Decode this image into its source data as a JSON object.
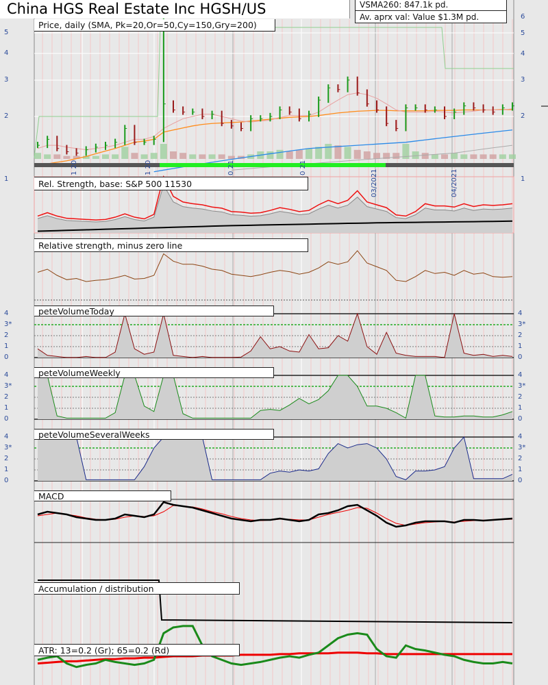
{
  "header": {
    "title": "China HGS Real Estate Inc HGSH/US",
    "vsma": "VSMA260: 847.1k pd.",
    "avg_value": "Av. aprx val: Value $1.3M pd."
  },
  "panels": {
    "price": "Price, daily (SMA, Pk=20,Or=50,Cy=150,Gry=200)",
    "rs": "Rel. Strength, base: S&P 500 11530",
    "rs_zero": "Relative strength, minus zero line",
    "vol_today": "peteVolumeToday",
    "vol_weekly": "peteVolumeWeekly",
    "vol_several": "peteVolumeSeveralWeeks",
    "macd": "MACD",
    "accdist": "Accumulation / distribution",
    "atr": "ATR: 13=0.2 (Gr); 65=0.2 (Rd)"
  },
  "axes": {
    "price_left": [
      "5",
      "4",
      "3",
      "2"
    ],
    "price_right": [
      "6",
      "5",
      "4",
      "3",
      "2"
    ],
    "rs": "1",
    "vol": [
      "4",
      "3*",
      "2",
      "1",
      "0"
    ],
    "dates": [
      "1 20",
      "1 20",
      "0 21",
      "0 21",
      "03/2021",
      "04/2021"
    ]
  },
  "colors": {
    "up": "#1a9a1a",
    "down": "#9a1a1a",
    "sma20": "#e8a0a0",
    "sma50": "#ff8c1a",
    "sma150": "#2a8ae8",
    "sma200": "#aaaaaa",
    "rs": "#ee1111",
    "rszero": "#8b4513",
    "vol": "#8b1010",
    "volw": "#1a8a1a",
    "vols": "#1a2a8a"
  },
  "chart_data": [
    {
      "type": "bar",
      "title": "Price, daily",
      "scale": "log",
      "close": [
        1.45,
        1.55,
        1.4,
        1.35,
        1.33,
        1.38,
        1.42,
        1.45,
        1.5,
        1.75,
        1.5,
        1.5,
        1.55,
        2.3,
        2.15,
        2.1,
        2.1,
        2.0,
        2.05,
        1.85,
        1.8,
        1.75,
        1.95,
        1.95,
        2.0,
        2.15,
        2.1,
        1.95,
        2.05,
        2.4,
        2.75,
        2.7,
        3.0,
        2.6,
        2.3,
        2.15,
        1.85,
        1.75,
        2.2,
        2.2,
        2.15,
        2.15,
        2.0,
        2.1,
        2.25,
        2.2,
        2.15,
        2.1,
        2.2,
        2.25
      ],
      "spike_high": 6.0,
      "sma20": [
        1.4,
        1.45,
        1.45,
        1.42,
        1.4,
        1.38,
        1.4,
        1.42,
        1.45,
        1.5,
        1.55,
        1.55,
        1.6,
        1.75,
        1.85,
        1.95,
        2.0,
        2.05,
        2.05,
        2.0,
        1.95,
        1.9,
        1.88,
        1.9,
        1.92,
        1.98,
        2.02,
        2.02,
        2.02,
        2.1,
        2.25,
        2.4,
        2.55,
        2.6,
        2.55,
        2.45,
        2.3,
        2.15,
        2.1,
        2.1,
        2.1,
        2.12,
        2.1,
        2.08,
        2.1,
        2.12,
        2.15,
        2.15,
        2.15,
        2.18
      ],
      "sma50": [
        1.15,
        1.18,
        1.2,
        1.22,
        1.25,
        1.28,
        1.32,
        1.36,
        1.4,
        1.45,
        1.5,
        1.52,
        1.55,
        1.68,
        1.72,
        1.76,
        1.8,
        1.83,
        1.85,
        1.86,
        1.87,
        1.88,
        1.9,
        1.92,
        1.94,
        1.96,
        1.98,
        1.99,
        2.0,
        2.02,
        2.05,
        2.08,
        2.1,
        2.12,
        2.13,
        2.14,
        2.14,
        2.13,
        2.13,
        2.13,
        2.13,
        2.14,
        2.14,
        2.14,
        2.15,
        2.15,
        2.15,
        2.15,
        2.16,
        2.16
      ],
      "sma150": [
        null,
        null,
        null,
        null,
        null,
        null,
        null,
        null,
        null,
        null,
        null,
        null,
        1.08,
        1.1,
        1.12,
        1.14,
        1.16,
        1.18,
        1.2,
        1.22,
        1.24,
        1.26,
        1.28,
        1.3,
        1.32,
        1.34,
        1.36,
        1.38,
        1.4,
        1.41,
        1.42,
        1.43,
        1.44,
        1.45,
        1.46,
        1.47,
        1.48,
        1.49,
        1.5,
        1.52,
        1.54,
        1.56,
        1.58,
        1.6,
        1.62,
        1.64,
        1.66,
        1.68,
        1.7,
        1.72
      ],
      "sma200": [
        null,
        null,
        null,
        null,
        null,
        null,
        null,
        null,
        null,
        null,
        null,
        null,
        null,
        null,
        null,
        null,
        null,
        null,
        null,
        null,
        1.1,
        1.11,
        1.12,
        1.13,
        1.14,
        1.15,
        1.16,
        1.17,
        1.18,
        1.19,
        1.2,
        1.21,
        1.22,
        1.23,
        1.24,
        1.25,
        1.26,
        1.27,
        1.28,
        1.29,
        1.3,
        1.31,
        1.32,
        1.33,
        1.35,
        1.37,
        1.39,
        1.41,
        1.43,
        1.45
      ],
      "volume": [
        0.4,
        0.3,
        0.3,
        0.2,
        0.2,
        0.2,
        0.2,
        0.3,
        0.3,
        0.8,
        0.4,
        0.3,
        0.4,
        1.0,
        0.5,
        0.4,
        0.3,
        0.3,
        0.3,
        0.3,
        0.2,
        0.2,
        0.3,
        0.5,
        0.5,
        0.6,
        0.5,
        0.6,
        0.7,
        0.8,
        1.0,
        0.9,
        0.8,
        0.6,
        0.5,
        0.4,
        0.4,
        0.4,
        1.0,
        0.5,
        0.4,
        0.3,
        0.3,
        0.4,
        0.3,
        0.3,
        0.3,
        0.3,
        0.3,
        0.3
      ]
    },
    {
      "type": "line",
      "title": "Rel. Strength",
      "rs": [
        30,
        36,
        30,
        26,
        25,
        24,
        23,
        24,
        28,
        34,
        28,
        25,
        33,
        100,
        65,
        55,
        52,
        50,
        46,
        44,
        38,
        37,
        35,
        36,
        40,
        45,
        42,
        38,
        40,
        50,
        58,
        52,
        58,
        75,
        55,
        50,
        45,
        32,
        30,
        38,
        52,
        48,
        48,
        46,
        52,
        47,
        50,
        49,
        50,
        52
      ],
      "base": [
        3,
        3.5,
        4,
        4.5,
        5,
        5.5,
        6,
        6.5,
        7,
        7.5,
        8,
        8.5,
        9,
        9.5,
        10,
        10.5,
        11,
        11.5,
        12,
        12.5,
        13,
        13.3,
        13.6,
        14,
        14.3,
        14.6,
        15,
        15.3,
        15.6,
        16,
        16.3,
        16.6,
        17,
        17.3,
        17.6,
        18,
        18.2,
        18.4,
        18.6,
        18.8,
        19,
        19.2,
        19.4,
        19.6,
        19.8,
        20,
        20.2,
        20.4,
        20.7,
        21
      ]
    },
    {
      "type": "line",
      "title": "Relative strength, minus zero line",
      "values": [
        45,
        50,
        40,
        33,
        35,
        30,
        32,
        33,
        36,
        40,
        34,
        35,
        40,
        75,
        63,
        58,
        58,
        55,
        50,
        48,
        42,
        40,
        38,
        41,
        45,
        48,
        46,
        42,
        45,
        52,
        62,
        58,
        62,
        80,
        60,
        54,
        48,
        32,
        30,
        38,
        48,
        43,
        45,
        40,
        48,
        42,
        44,
        38,
        37,
        38
      ]
    },
    {
      "type": "area",
      "title": "peteVolumeToday",
      "ylim": [
        0,
        4
      ],
      "values": [
        0.8,
        0.2,
        0.1,
        0,
        0,
        0.1,
        0,
        0,
        0.5,
        4,
        0.8,
        0.3,
        0.5,
        4,
        0.2,
        0.1,
        0,
        0.1,
        0,
        0,
        0,
        0.05,
        0.6,
        1.9,
        0.8,
        1.0,
        0.6,
        0.5,
        2.1,
        0.8,
        0.9,
        2.0,
        1.5,
        4,
        1.0,
        0.3,
        2.3,
        0.4,
        0.2,
        0.1,
        0.1,
        0.1,
        0,
        4,
        0.4,
        0.2,
        0.3,
        0.1,
        0.2,
        0.1
      ]
    },
    {
      "type": "area",
      "title": "peteVolumeWeekly",
      "ylim": [
        0,
        4
      ],
      "values": [
        4,
        4,
        0.3,
        0.1,
        0.1,
        0.1,
        0.1,
        0.1,
        0.6,
        4,
        4,
        1.2,
        0.7,
        4,
        4,
        0.5,
        0.1,
        0.1,
        0.1,
        0.1,
        0.1,
        0.1,
        0.1,
        0.8,
        0.9,
        0.8,
        1.3,
        1.9,
        1.4,
        1.8,
        2.6,
        4,
        4,
        3,
        1.2,
        1.2,
        1.0,
        0.6,
        0.1,
        4,
        4,
        0.3,
        0.2,
        0.2,
        0.3,
        0.3,
        0.2,
        0.2,
        0.4,
        0.7
      ]
    },
    {
      "type": "area",
      "title": "peteVolumeSeveralWeeks",
      "ylim": [
        0,
        4
      ],
      "values": [
        4,
        4,
        4,
        4,
        4,
        0.1,
        0.1,
        0.1,
        0.1,
        0.1,
        0.1,
        1.3,
        3,
        4,
        4,
        4,
        4,
        4,
        0.1,
        0.1,
        0.1,
        0.1,
        0.1,
        0.1,
        0.7,
        0.9,
        0.8,
        1.0,
        0.9,
        1.1,
        2.5,
        3.4,
        3.0,
        3.3,
        3.4,
        3.0,
        2.0,
        0.4,
        0.1,
        0.9,
        0.9,
        1.0,
        1.3,
        3,
        4,
        0.2,
        0.2,
        0.2,
        0.2,
        0.6
      ]
    },
    {
      "type": "line",
      "title": "MACD",
      "macd": [
        0.3,
        0.5,
        0.4,
        0.3,
        0.1,
        0,
        -0.1,
        -0.1,
        0,
        0.3,
        0.2,
        0.1,
        0.3,
        1.2,
        1.0,
        0.9,
        0.8,
        0.6,
        0.4,
        0.2,
        0,
        -0.1,
        -0.2,
        -0.1,
        -0.1,
        0,
        -0.1,
        -0.2,
        -0.1,
        0.3,
        0.4,
        0.6,
        0.9,
        1.0,
        0.6,
        0.2,
        -0.3,
        -0.6,
        -0.5,
        -0.3,
        -0.2,
        -0.2,
        -0.2,
        -0.3,
        -0.1,
        -0.1,
        -0.15,
        -0.1,
        -0.05,
        0
      ],
      "signal": [
        0.2,
        0.3,
        0.4,
        0.3,
        0.2,
        0.05,
        -0.05,
        -0.1,
        -0.05,
        0.1,
        0.2,
        0.15,
        0.2,
        0.5,
        0.95,
        0.9,
        0.85,
        0.7,
        0.5,
        0.35,
        0.15,
        0,
        -0.1,
        -0.15,
        -0.12,
        -0.05,
        -0.05,
        -0.1,
        -0.1,
        0.1,
        0.3,
        0.45,
        0.6,
        0.8,
        0.75,
        0.4,
        0,
        -0.35,
        -0.5,
        -0.4,
        -0.3,
        -0.25,
        -0.2,
        -0.25,
        -0.2,
        -0.15,
        -0.12,
        -0.1,
        -0.08,
        -0.05
      ]
    },
    {
      "type": "line",
      "title": "Accumulation / distribution",
      "values": [
        100,
        100,
        100,
        100,
        100,
        100,
        100,
        100,
        100,
        100,
        100,
        100,
        100,
        42,
        41,
        41,
        41,
        40,
        40,
        40,
        40,
        40,
        40,
        40,
        40,
        40,
        40,
        40,
        40,
        40,
        40,
        40,
        40,
        40,
        40,
        40,
        40,
        40,
        38,
        38,
        38,
        38,
        38,
        38,
        38,
        38,
        38,
        38,
        38,
        38
      ]
    },
    {
      "type": "line",
      "title": "ATR",
      "atr13": [
        35,
        38,
        40,
        30,
        25,
        28,
        30,
        35,
        32,
        30,
        28,
        30,
        35,
        72,
        80,
        82,
        82,
        55,
        40,
        35,
        30,
        28,
        30,
        32,
        35,
        38,
        40,
        38,
        42,
        45,
        55,
        65,
        70,
        72,
        70,
        50,
        40,
        38,
        55,
        50,
        48,
        45,
        42,
        40,
        35,
        32,
        30,
        30,
        32,
        30
      ],
      "atr65": [
        30,
        31,
        32,
        33,
        33,
        34,
        35,
        36,
        36,
        37,
        37,
        38,
        38,
        39,
        40,
        40,
        40,
        41,
        41,
        41,
        41,
        42,
        42,
        42,
        42,
        43,
        43,
        44,
        44,
        44,
        44,
        45,
        45,
        45,
        44,
        44,
        43,
        43,
        43,
        43,
        43,
        43,
        43,
        43,
        43,
        43,
        43,
        43,
        43,
        43
      ]
    }
  ]
}
